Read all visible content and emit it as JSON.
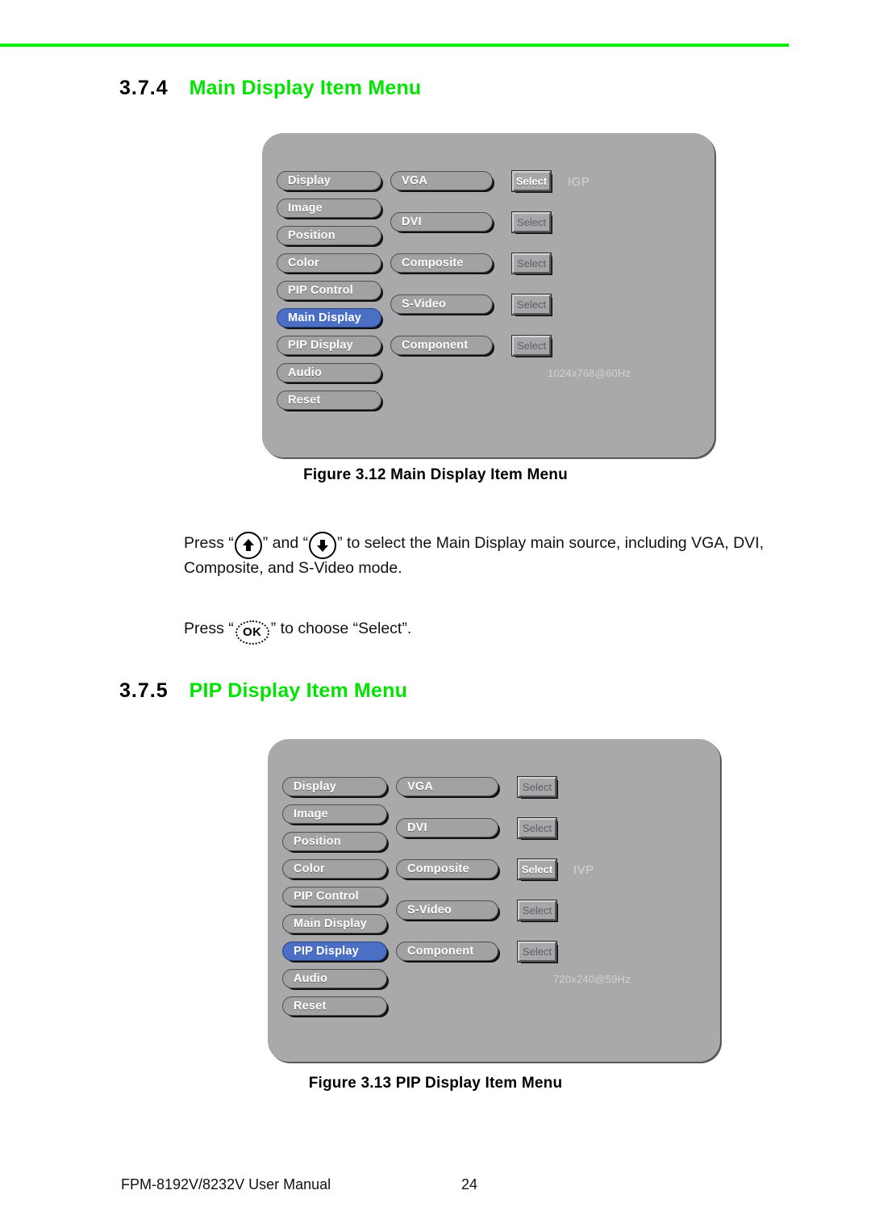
{
  "page": {
    "rule_color": "#00ec00",
    "heading_color": "#00e400"
  },
  "sections": [
    {
      "number": "3.7.4",
      "title": "Main Display Item Menu"
    },
    {
      "number": "3.7.5",
      "title": "PIP Display Item Menu"
    }
  ],
  "figures": [
    {
      "caption": "Figure 3.12 Main Display Item Menu",
      "osd": {
        "left_menu": [
          "Display",
          "Image",
          "Position",
          "Color",
          "PIP Control",
          "Main Display",
          "PIP Display",
          "Audio",
          "Reset"
        ],
        "selected_left_item": "Main Display",
        "sources": [
          "VGA",
          "DVI",
          "Composite",
          "S-Video",
          "Component"
        ],
        "select_label": "Select",
        "active_select_index": 0,
        "source_tag": "IGP",
        "resolution": "1024x768@60Hz"
      }
    },
    {
      "caption": "Figure 3.13 PIP Display Item Menu",
      "osd": {
        "left_menu": [
          "Display",
          "Image",
          "Position",
          "Color",
          "PIP Control",
          "Main Display",
          "PIP Display",
          "Audio",
          "Reset"
        ],
        "selected_left_item": "PIP Display",
        "sources": [
          "VGA",
          "DVI",
          "Composite",
          "S-Video",
          "Component"
        ],
        "select_label": "Select",
        "active_select_index": 2,
        "source_tag": "IVP",
        "resolution": "720x240@59Hz"
      }
    }
  ],
  "paragraphs": {
    "press_updown": {
      "press": "Press “",
      "quote_and": "” and “",
      "tail": "” to select the Main Display main source, including VGA, DVI,",
      "line2": "Composite, and S-Video mode.",
      "up_icon": "arrow-up-key-icon",
      "down_icon": "arrow-down-key-icon"
    },
    "press_ok": {
      "press": "Press “",
      "tail": "” to choose “Select”.",
      "ok_icon": "ok-key-icon",
      "ok_label": "OK"
    }
  },
  "footer": {
    "manual": "FPM-8192V/8232V User Manual",
    "page_number": "24"
  }
}
